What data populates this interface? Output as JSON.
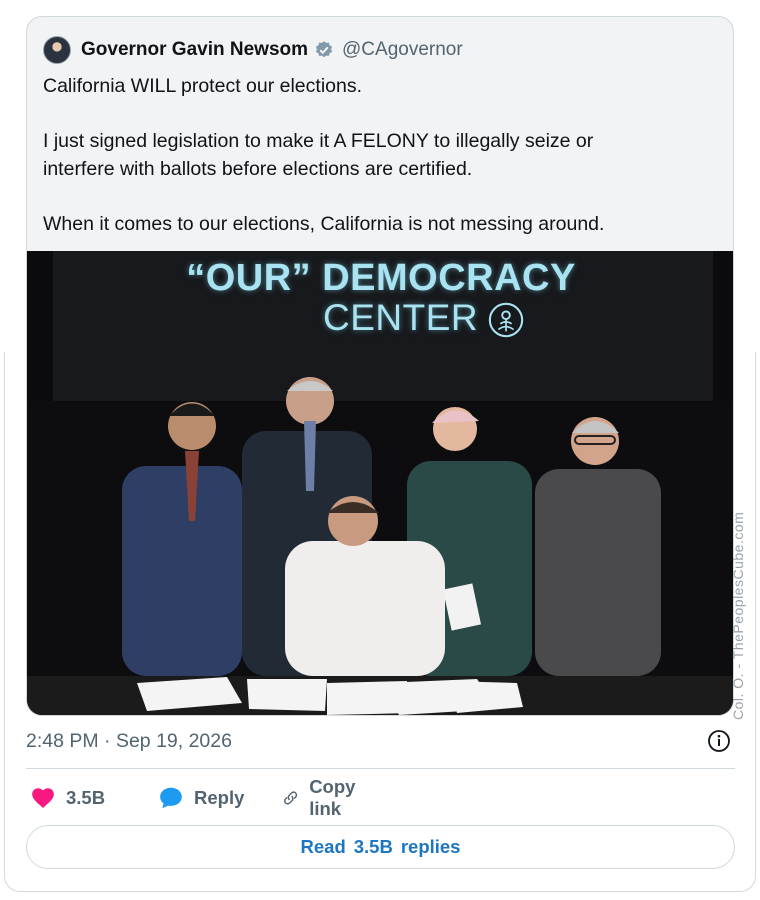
{
  "quoted_tweet": {
    "display_name": "Governor Gavin Newsom",
    "handle": "@CAgovernor",
    "text_lines": [
      "California WILL protect our elections.",
      "I just signed legislation to make it A FELONY to illegally seize or",
      "interfere with ballots before elections are certified.",
      "When it comes to our elections, California is not messing around."
    ]
  },
  "media": {
    "banner_line1": "“OUR” DEMOCRACY",
    "banner_line2": "CENTER",
    "watermark": "Col. O. - ThePeoplesCube.com"
  },
  "timestamp": "2:48 PM · Sep 19, 2026",
  "actions": {
    "like_count": "3.5B",
    "reply_label": "Reply",
    "copy_label": "Copy link"
  },
  "read_replies": {
    "prefix": "Read",
    "count": "3.5B",
    "suffix": "replies"
  },
  "colors": {
    "like": "#f91880",
    "reply": "#1d9bf0",
    "verified": "#829aab",
    "link": "#1d76c2"
  },
  "icons": [
    "verified-badge-icon",
    "info-icon",
    "heart-icon",
    "speech-bubble-icon",
    "link-icon",
    "avatar"
  ]
}
